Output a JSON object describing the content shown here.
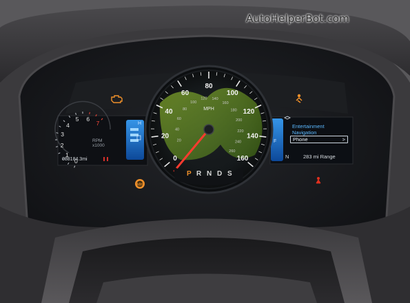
{
  "watermark": "AutoHelperBot.com",
  "speedometer": {
    "unit": "MPH",
    "mph_ticks": [
      "0",
      "20",
      "40",
      "60",
      "80",
      "100",
      "120",
      "140",
      "160"
    ],
    "kmh_ticks": [
      "20",
      "40",
      "60",
      "80",
      "100",
      "120",
      "140",
      "160",
      "180",
      "200",
      "220",
      "240",
      "260"
    ],
    "needle_mph": 0
  },
  "tachometer": {
    "ticks": [
      "0",
      "1",
      "2",
      "3",
      "4",
      "5",
      "6",
      "7"
    ],
    "unit_line1": "RPM",
    "unit_line2": "x1000"
  },
  "odometer": "088184.3mi",
  "gear_selector": {
    "gears": [
      "P",
      "R",
      "N",
      "D",
      "S"
    ],
    "active": "P"
  },
  "info_display": {
    "menu": [
      "Entertainment",
      "Navigation",
      "Phone"
    ],
    "selected": "Phone",
    "chevron": ">",
    "compass": "N",
    "range": "283 mi Range"
  },
  "fuel_gauge": {
    "full_label": "F"
  },
  "temp_gauge": {
    "hot_label": "H"
  },
  "colors": {
    "needle": "#ff3b2f",
    "menu_blue": "#5bb8ff",
    "warning_amber": "#f0902a",
    "warning_red": "#e0301e",
    "gauge_blue": "#1a7be0"
  },
  "icons": [
    "check-engine-icon",
    "seatbelt-warning-icon",
    "abs-warning-icon",
    "airbag-warning-icon",
    "compass-icon"
  ]
}
